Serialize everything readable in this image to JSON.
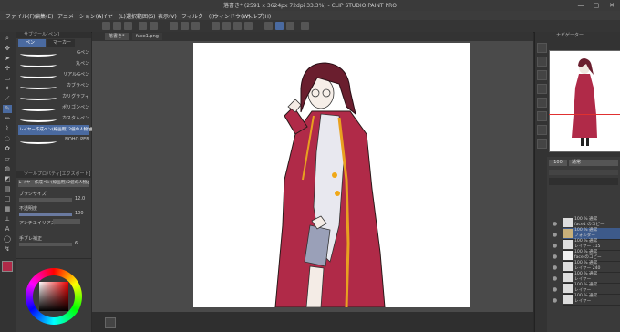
{
  "titlebar": {
    "title": "落書き* (2591 x 3624px 72dpi 33.3%) - CLIP STUDIO PAINT PRO",
    "minimize": "—",
    "maximize": "▢",
    "close": "✕"
  },
  "menu": [
    "ファイル(F)",
    "編集(E)",
    "アニメーション(A)",
    "レイヤー(L)",
    "選択範囲(S)",
    "表示(V)",
    "フィルター(I)",
    "ウィンドウ(W)",
    "ヘルプ(H)"
  ],
  "subtool": {
    "header": "サブツール[ペン]",
    "tabs": [
      "ペン",
      "マーカー"
    ],
    "brushes": [
      "Gペン",
      "丸ペン",
      "リアルGペン",
      "カブラペン",
      "カリグラフィ",
      "ポリゴンペン",
      "カスタムペン",
      "NOHO PEN"
    ]
  },
  "toolprop": {
    "header": "ツールプロパティ[エクスポート]",
    "line1": "レイヤー作成ペン(線画用) 2値の人物/曲線",
    "brush_size_label": "ブラシサイズ",
    "brush_size_value": "12.0",
    "opacity_label": "不透明度",
    "opacity_value": "100",
    "aa_label": "アンチエイリアス",
    "correction_label": "手ブレ補正",
    "correction_value": "6"
  },
  "tabs": [
    "落書き*",
    "face1.png"
  ],
  "navigator": {
    "header": "ナビゲーター"
  },
  "layerpanel": {
    "mode": "通常",
    "opacity": "100"
  },
  "layers": [
    {
      "line1": "100 % 通常",
      "line2": "face1 のコピー"
    },
    {
      "line1": "100 % 通常",
      "line2": "フォルダー"
    },
    {
      "line1": "100 % 通常",
      "line2": "レイヤー 115"
    },
    {
      "line1": "100 % 通常",
      "line2": "face のコピー"
    },
    {
      "line1": "100 % 通常",
      "line2": "レイヤー 240"
    },
    {
      "line1": "100 % 通常",
      "line2": "レイヤー"
    },
    {
      "line1": "100 % 通常",
      "line2": "レイヤー"
    },
    {
      "line1": "100 % 通常",
      "line2": "レイヤー"
    }
  ],
  "colors": {
    "main": "#b02a48",
    "accent": "#4a78c8",
    "selected_layer": "#3d5a8a"
  }
}
